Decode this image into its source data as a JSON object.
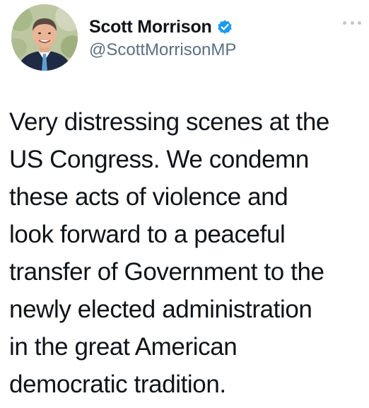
{
  "author": {
    "display_name": "Scott Morrison",
    "handle": "@ScottMorrisonMP",
    "verified": true,
    "avatar_icon": "profile-photo",
    "verified_icon": "verified-badge-icon",
    "verified_color": "#1d9bf0"
  },
  "menu": {
    "icon": "more-options-icon"
  },
  "tweet": {
    "lines": [
      "Very distressing scenes at the",
      "US Congress. We condemn",
      "these acts of violence and",
      "look forward to a peaceful",
      "transfer of Government to the",
      "newly elected administration",
      "in the great American",
      "democratic tradition."
    ]
  },
  "colors": {
    "text": "#0f1419",
    "secondary_text": "#5b7083",
    "background": "#ffffff"
  }
}
